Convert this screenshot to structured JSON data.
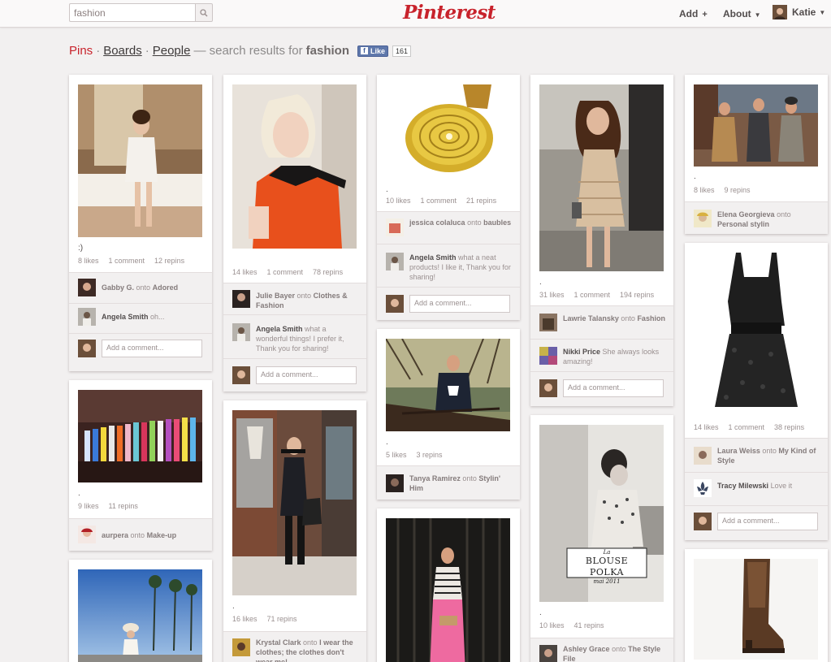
{
  "header": {
    "search_value": "fashion",
    "logo": "Pinterest",
    "add_label": "Add",
    "about_label": "About",
    "user_name": "Katie"
  },
  "subnav": {
    "pins": "Pins",
    "boards": "Boards",
    "people": "People",
    "results_prefix": "— search results for",
    "query": "fashion",
    "fb_like": "Like",
    "fb_count": "161"
  },
  "comment_placeholder": "Add a comment...",
  "pins": [
    {
      "desc": ":)",
      "likes": "8 likes",
      "comments": "1 comment",
      "repins": "12 repins",
      "activity": [
        {
          "name": "Gabby G.",
          "onto": "onto",
          "board": "Adored",
          "text": ""
        },
        {
          "name": "Angela Smith",
          "onto": "",
          "board": "",
          "text": "oh..."
        }
      ]
    },
    {
      "desc": ".",
      "likes": "9 likes",
      "comments": "",
      "repins": "11 repins",
      "activity": [
        {
          "name": "aurpera",
          "onto": "onto",
          "board": "Make-up",
          "text": ""
        }
      ]
    },
    {
      "desc": "",
      "likes": "14 likes",
      "comments": "1 comment",
      "repins": "78 repins",
      "activity": [
        {
          "name": "Julie Bayer",
          "onto": "onto",
          "board": "Clothes & Fashion",
          "text": ""
        },
        {
          "name": "Angela Smith",
          "onto": "",
          "board": "",
          "text": "what a wonderful things! I prefer it, Thank you for sharing!"
        }
      ]
    },
    {
      "desc": ".",
      "likes": "16 likes",
      "comments": "",
      "repins": "71 repins",
      "activity": [
        {
          "name": "Krystal Clark",
          "onto": "onto",
          "board": "I wear the clothes; the clothes don't wear me!",
          "text": ""
        }
      ]
    },
    {
      "desc": ".",
      "likes": "10 likes",
      "comments": "1 comment",
      "repins": "21 repins",
      "activity": [
        {
          "name": "jessica colaluca",
          "onto": "onto",
          "board": "baubles",
          "text": ""
        },
        {
          "name": "Angela Smith",
          "onto": "",
          "board": "",
          "text": "what a neat products! I like it, Thank you for sharing!"
        }
      ]
    },
    {
      "desc": ".",
      "likes": "5 likes",
      "comments": "",
      "repins": "3 repins",
      "activity": [
        {
          "name": "Tanya Ramirez",
          "onto": "onto",
          "board": "Stylin' Him",
          "text": ""
        }
      ]
    },
    {
      "desc": ".",
      "likes": "31 likes",
      "comments": "1 comment",
      "repins": "194 repins",
      "activity": [
        {
          "name": "Lawrie Talansky",
          "onto": "onto",
          "board": "Fashion",
          "text": ""
        },
        {
          "name": "Nikki Price",
          "onto": "",
          "board": "",
          "text": "She always looks amazing!"
        }
      ]
    },
    {
      "desc": ".",
      "likes": "10 likes",
      "comments": "",
      "repins": "41 repins",
      "img_text": {
        "small": "La",
        "big": "BLOUSE POLKA",
        "date": "mai 2011"
      },
      "activity": [
        {
          "name": "Ashley Grace",
          "onto": "onto",
          "board": "The Style File",
          "text": ""
        }
      ]
    },
    {
      "desc": ".",
      "likes": "8 likes",
      "comments": "",
      "repins": "9 repins",
      "activity": [
        {
          "name": "Elena Georgieva",
          "onto": "onto",
          "board": "Personal stylin",
          "text": ""
        }
      ]
    },
    {
      "desc": "",
      "likes": "14 likes",
      "comments": "1 comment",
      "repins": "38 repins",
      "activity": [
        {
          "name": "Laura Weiss",
          "onto": "onto",
          "board": "My Kind of Style",
          "text": ""
        },
        {
          "name": "Tracy Milewski",
          "onto": "",
          "board": "",
          "text": "Love it"
        }
      ]
    }
  ],
  "colors": {
    "brand_red": "#c8232c",
    "background": "#f2f0f0"
  }
}
